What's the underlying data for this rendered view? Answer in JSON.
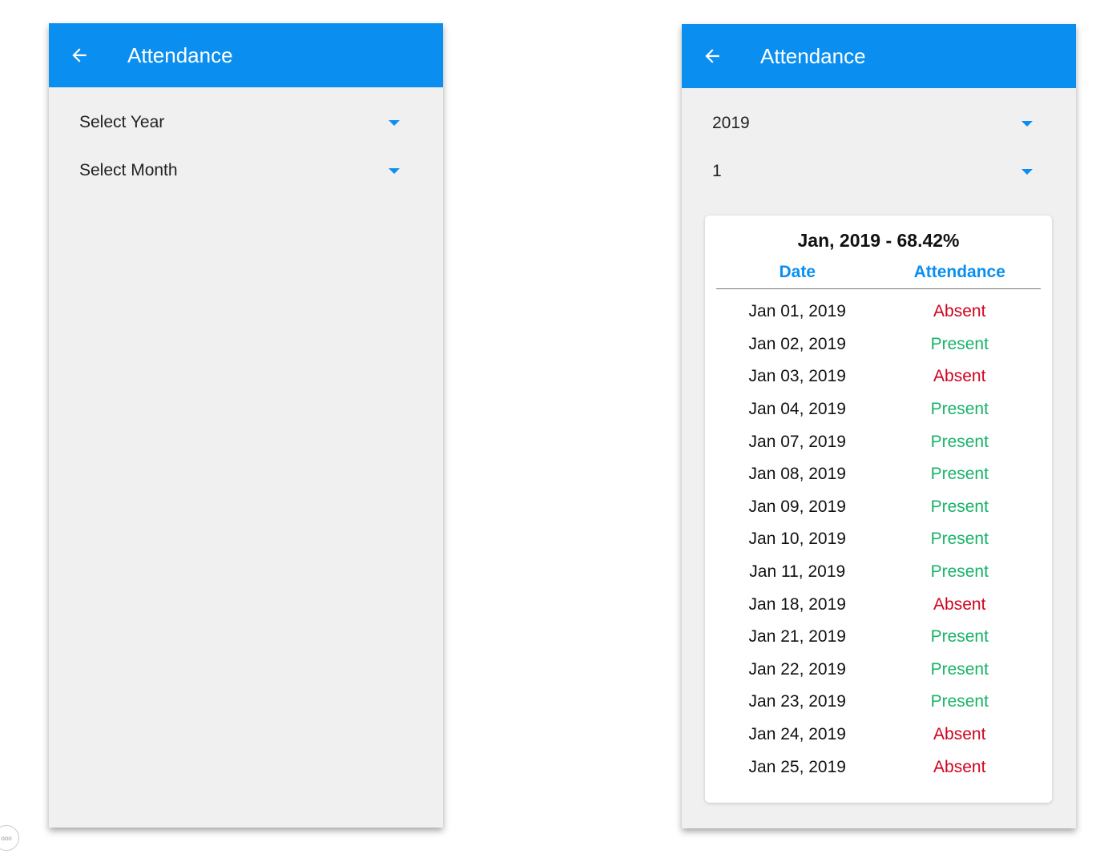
{
  "left_screen": {
    "title": "Attendance",
    "year_select": {
      "value": "Select Year"
    },
    "month_select": {
      "value": "Select Month"
    }
  },
  "right_screen": {
    "title": "Attendance",
    "year_select": {
      "value": "2019"
    },
    "month_select": {
      "value": "1"
    },
    "summary": {
      "title": "Jan, 2019 - 68.42%",
      "columns": [
        "Date",
        "Attendance"
      ],
      "rows": [
        {
          "date": "Jan 01, 2019",
          "status": "Absent"
        },
        {
          "date": "Jan 02, 2019",
          "status": "Present"
        },
        {
          "date": "Jan 03, 2019",
          "status": "Absent"
        },
        {
          "date": "Jan 04, 2019",
          "status": "Present"
        },
        {
          "date": "Jan 07, 2019",
          "status": "Present"
        },
        {
          "date": "Jan 08, 2019",
          "status": "Present"
        },
        {
          "date": "Jan 09, 2019",
          "status": "Present"
        },
        {
          "date": "Jan 10, 2019",
          "status": "Present"
        },
        {
          "date": "Jan 11, 2019",
          "status": "Present"
        },
        {
          "date": "Jan 18, 2019",
          "status": "Absent"
        },
        {
          "date": "Jan 21, 2019",
          "status": "Present"
        },
        {
          "date": "Jan 22, 2019",
          "status": "Present"
        },
        {
          "date": "Jan 23, 2019",
          "status": "Present"
        },
        {
          "date": "Jan 24, 2019",
          "status": "Absent"
        },
        {
          "date": "Jan 25, 2019",
          "status": "Absent"
        }
      ]
    }
  },
  "colors": {
    "appbar": "#0a8ff0",
    "absent": "#d0021b",
    "present": "#18b368",
    "background": "#f0f0f0"
  },
  "icons": {
    "back": "arrow-left-icon",
    "caret": "caret-down-icon"
  }
}
